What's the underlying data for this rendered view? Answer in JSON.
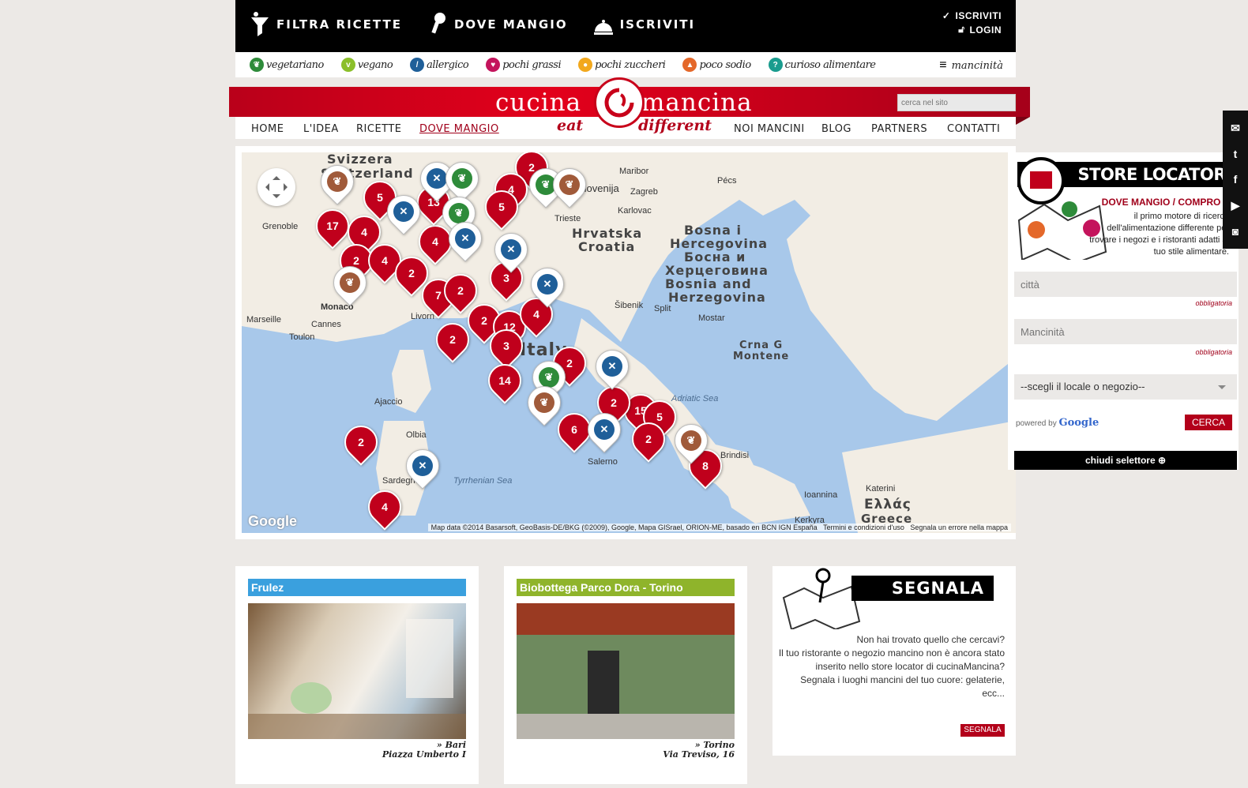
{
  "topnav": {
    "items": [
      {
        "label": "FILTRA RICETTE",
        "icon": "funnel-icon"
      },
      {
        "label": "DOVE MANGIO",
        "icon": "pin-icon"
      },
      {
        "label": "ISCRIVITI",
        "icon": "cloche-icon"
      }
    ],
    "account": {
      "register": "ISCRIVITI",
      "login": "LOGIN"
    }
  },
  "diets": [
    {
      "label": "vegetariano",
      "color": "#2e8b3a"
    },
    {
      "label": "vegano",
      "color": "#8bbf2a"
    },
    {
      "label": "allergico",
      "color": "#1f5f99"
    },
    {
      "label": "pochi grassi",
      "color": "#c4145c"
    },
    {
      "label": "pochi zuccheri",
      "color": "#f2a81d"
    },
    {
      "label": "poco sodio",
      "color": "#e4682a"
    },
    {
      "label": "curioso alimentare",
      "color": "#1a9c8e"
    }
  ],
  "mancinita_label": "mancinità",
  "logo": {
    "left": "cucina",
    "right": "mancina",
    "tag_left": "eat",
    "tag_right": "different"
  },
  "search_placeholder": "cerca nel sito",
  "mainnav": [
    "HOME",
    "L'IDEA",
    "RICETTE",
    "DOVE MANGIO",
    "NOI MANCINI",
    "BLOG",
    "PARTNERS",
    "CONTATTI"
  ],
  "map": {
    "labels": {
      "svizzera": "Svizzera",
      "switzerland": "Switzerland",
      "slovenija": "Slovenija",
      "hrvatska": "Hrvatska",
      "croatia": "Croatia",
      "bosna1": "Bosna i",
      "bosna2": "Hercegovina",
      "bosna3": "Босна и",
      "bosna4": "Херцеговина",
      "bosna5": "Bosnia and",
      "bosna6": "Herzegovina",
      "italy": "Italy",
      "grenoble": "Grenoble",
      "monaco": "Monaco",
      "marseille": "Marseille",
      "cannes": "Cannes",
      "toulon": "Toulon",
      "ajaccio": "Ajaccio",
      "olbia": "Olbia",
      "sardegna": "Sardegna",
      "tyrrhenian": "Tyrrhenian Sea",
      "adriatic": "Adriatic Sea",
      "zagreb": "Zagreb",
      "maribor": "Maribor",
      "pecs": "Pécs",
      "karlovac": "Karlovac",
      "sibenik": "Šibenik",
      "split": "Split",
      "mostar": "Mostar",
      "crna": "Crna G",
      "montene": "Montene",
      "trieste": "Trieste",
      "livorno": "Livorn",
      "salerno": "Salerno",
      "brindisi": "Brindisi",
      "ellada": "Ελλάς",
      "greece": "Greece",
      "ioannina": "Ioannina",
      "kerkyra": "Kerkyra",
      "katerini": "Katerini"
    },
    "attribution": "Map data ©2014 Basarsoft, GeoBasis-DE/BKG (©2009), Google, Mapa GISrael, ORION-ME, basado en BCN IGN España",
    "terms": "Termini e condizioni d'uso",
    "report": "Segnala un errore nella mappa",
    "google": "Google",
    "markers_red": [
      "2",
      "5",
      "17",
      "4",
      "4",
      "2",
      "4",
      "2",
      "4",
      "5",
      "13",
      "7",
      "2",
      "3",
      "2",
      "12",
      "3",
      "4",
      "2",
      "14",
      "2",
      "15",
      "5",
      "6",
      "2",
      "8",
      "2",
      "4",
      "2"
    ]
  },
  "locator": {
    "title": "STORE LOCATOR",
    "subtitle": "DOVE MANGIO / COMPRO ?",
    "description": "il primo motore di ricerca dell'alimentazione differente per trovare i negozi e i ristoranti adatti al tuo stile alimentare.",
    "city_placeholder": "città",
    "required": "obbligatoria",
    "mancinita_placeholder": "Mancinità",
    "select_value": "--scegli il locale o negozio--",
    "powered_by": "powered by",
    "google": "Google",
    "search_button": "CERCA",
    "close_button": "chiudi selettore"
  },
  "social": [
    "mail-icon",
    "twitter-icon",
    "facebook-icon",
    "youtube-icon",
    "instagram-icon"
  ],
  "cards": [
    {
      "title": "Frulez",
      "color": "#3aa0de",
      "city": "» Bari",
      "address": "Piazza Umberto I"
    },
    {
      "title": "Biobottega Parco Dora - Torino",
      "color": "#8fb42b",
      "city": "» Torino",
      "address": "Via Treviso, 16"
    }
  ],
  "segnala": {
    "title": "SEGNALA",
    "line1": "Non hai trovato quello che cercavi?",
    "line2": "Il tuo ristorante o negozio mancino non è ancora stato inserito nello store locator di cucinaMancina?",
    "line3": "Segnala i luoghi mancini del tuo cuore: gelaterie, ecc...",
    "button": "SEGNALA"
  }
}
